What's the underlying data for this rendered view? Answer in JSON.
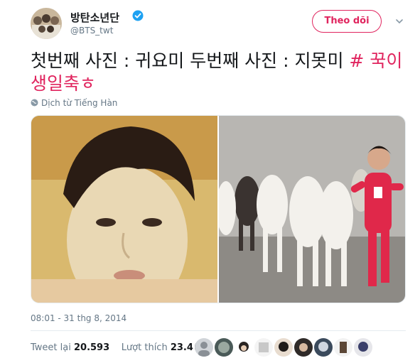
{
  "account": {
    "name": "방탄소년단",
    "handle": "@BTS_twt",
    "follow_label": "Theo dõi"
  },
  "tweet": {
    "text": "첫번째 사진 : 귀요미 두번째 사진 : 지못미 ",
    "hashtag": "# 꾹이생일축ㅎ",
    "translate_label": "Dịch từ Tiếng Hàn",
    "timestamp": "08:01 - 31 thg 8, 2014"
  },
  "stats": {
    "retweets_label": "Tweet lại",
    "retweets_count": "20.593",
    "likes_label": "Lượt thích",
    "likes_count": "23.407"
  },
  "colors": {
    "accent": "#e0245e",
    "verified": "#1da1f2",
    "muted": "#657786"
  },
  "icons": [
    "verified-badge-icon",
    "chevron-down-icon",
    "globe-icon"
  ]
}
